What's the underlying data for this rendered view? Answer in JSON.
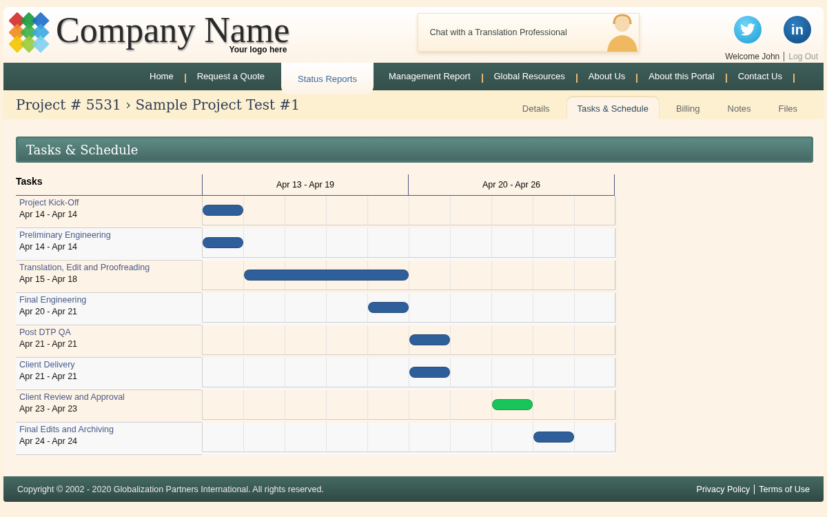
{
  "logo": {
    "name": "Company Name",
    "tagline": "Your logo here"
  },
  "chat": {
    "label": "Chat with a Translation Professional"
  },
  "social": [
    {
      "kind": "twitter"
    },
    {
      "kind": "linkedin",
      "label": "in"
    }
  ],
  "user": {
    "welcome": "Welcome John",
    "logout": "Log Out"
  },
  "nav": [
    {
      "label": "Home",
      "selected": false
    },
    {
      "label": "Request a Quote",
      "selected": false
    },
    {
      "label": "Status Reports",
      "selected": true
    },
    {
      "label": "Management Report",
      "selected": false
    },
    {
      "label": "Global Resources",
      "selected": false
    },
    {
      "label": "About Us",
      "selected": false
    },
    {
      "label": "About this Portal",
      "selected": false
    },
    {
      "label": "Contact Us",
      "selected": false
    }
  ],
  "breadcrumb": "Project # 5531 › Sample Project Test #1",
  "subtabs": [
    {
      "label": "Details",
      "selected": false
    },
    {
      "label": "Tasks & Schedule",
      "selected": true
    },
    {
      "label": "Billing",
      "selected": false
    },
    {
      "label": "Notes",
      "selected": false
    },
    {
      "label": "Files",
      "selected": false
    }
  ],
  "section_title": "Tasks & Schedule",
  "gantt": {
    "tasks_heading": "Tasks",
    "weeks": [
      "Apr 13 - Apr 19",
      "Apr 20 - Apr 26"
    ],
    "tasks": [
      {
        "name": "Project Kick-Off",
        "dates": "Apr 14 - Apr 14",
        "color": "#2f5f9a",
        "cells": [
          true,
          false,
          false,
          false,
          false,
          false,
          false,
          false,
          false,
          false
        ]
      },
      {
        "name": "Preliminary Engineering",
        "dates": "Apr 14 - Apr 14",
        "color": "#2f5f9a",
        "cells": [
          true,
          false,
          false,
          false,
          false,
          false,
          false,
          false,
          false,
          false
        ]
      },
      {
        "name": "Translation, Edit and Proofreading",
        "dates": "Apr 15 - Apr 18",
        "color": "#2f5f9a",
        "cells": [
          false,
          true,
          true,
          true,
          true,
          false,
          false,
          false,
          false,
          false
        ]
      },
      {
        "name": "Final Engineering",
        "dates": "Apr 20 - Apr 21",
        "color": "#2f5f9a",
        "cells": [
          false,
          false,
          false,
          false,
          true,
          false,
          false,
          false,
          false,
          false
        ]
      },
      {
        "name": "Post DTP QA",
        "dates": "Apr 21 - Apr 21",
        "color": "#2f5f9a",
        "cells": [
          false,
          false,
          false,
          false,
          false,
          true,
          false,
          false,
          false,
          false
        ]
      },
      {
        "name": "Client Delivery",
        "dates": "Apr 21 - Apr 21",
        "color": "#2f5f9a",
        "cells": [
          false,
          false,
          false,
          false,
          false,
          true,
          false,
          false,
          false,
          false
        ]
      },
      {
        "name": "Client Review and Approval",
        "dates": "Apr 23 - Apr 23",
        "color": "#19c45a",
        "cells": [
          false,
          false,
          false,
          false,
          false,
          false,
          false,
          true,
          false,
          false
        ]
      },
      {
        "name": "Final Edits and Archiving",
        "dates": "Apr 24 - Apr 24",
        "color": "#2f5f9a",
        "cells": [
          false,
          false,
          false,
          false,
          false,
          false,
          false,
          false,
          true,
          false
        ]
      }
    ]
  },
  "footer": {
    "copyright": "Copyright © 2002 - 2020 Globalization Partners International. All rights reserved.",
    "links": [
      "Privacy Policy",
      "Terms of Use"
    ]
  }
}
